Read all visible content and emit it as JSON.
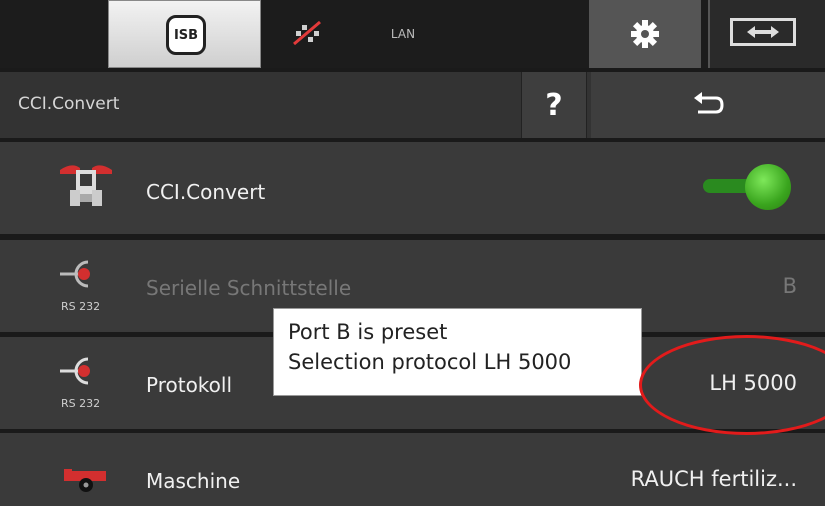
{
  "topbar": {
    "isb_label": "ISB",
    "lan_label": "LAN",
    "icons": [
      "isb-icon",
      "gps-off-icon",
      "gear-icon",
      "screen-switch-icon"
    ]
  },
  "header": {
    "title": "CCI.Convert",
    "help_label": "?"
  },
  "rows": [
    {
      "label": "CCI.Convert",
      "value": "",
      "icon": "tractor-icon",
      "toggle_on": true
    },
    {
      "label": "Serielle Schnittstelle",
      "value": "B",
      "icon": "rs232-icon",
      "icon_text": "RS 232",
      "disabled": true
    },
    {
      "label": "Protokoll",
      "value": "LH 5000",
      "icon": "rs232-icon",
      "icon_text": "RS 232"
    },
    {
      "label": "Maschine",
      "value": "RAUCH fertiliz...",
      "icon": "trailer-icon"
    }
  ],
  "callout": {
    "line1": "Port B is preset",
    "line2": "Selection protocol LH 5000"
  },
  "colors": {
    "accent_green": "#3aa51e",
    "highlight_red": "#e21b1b",
    "icon_red": "#d32f2f"
  }
}
